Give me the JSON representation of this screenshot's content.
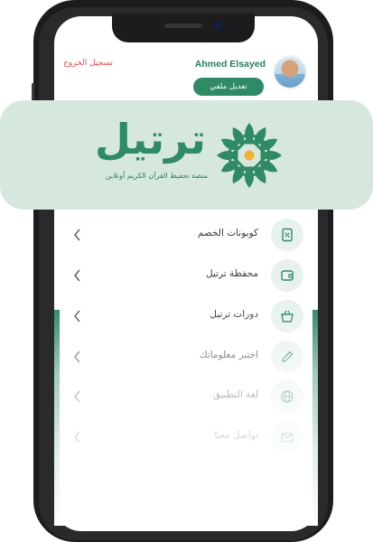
{
  "profile": {
    "name": "Ahmed Elsayed",
    "edit_label": "تعديل ملفي",
    "logout_label": "تسجيل الخروج"
  },
  "brand": {
    "name": "ترتيل",
    "tagline": "منصة تحفيظ القرآن الكريم أونلاين",
    "color": "#2f8a66",
    "accent": "#f2b233"
  },
  "menu": {
    "items": [
      {
        "label": "كوبونات الخصم",
        "icon": "coupon-icon"
      },
      {
        "label": "محفظة ترتيل",
        "icon": "wallet-icon"
      },
      {
        "label": "دورات ترتيل",
        "icon": "basket-icon"
      },
      {
        "label": "اختبر معلوماتك",
        "icon": "pencil-icon"
      },
      {
        "label": "لغة التطبيق",
        "icon": "globe-icon"
      },
      {
        "label": "تواصل معنا",
        "icon": "mail-icon"
      }
    ]
  }
}
